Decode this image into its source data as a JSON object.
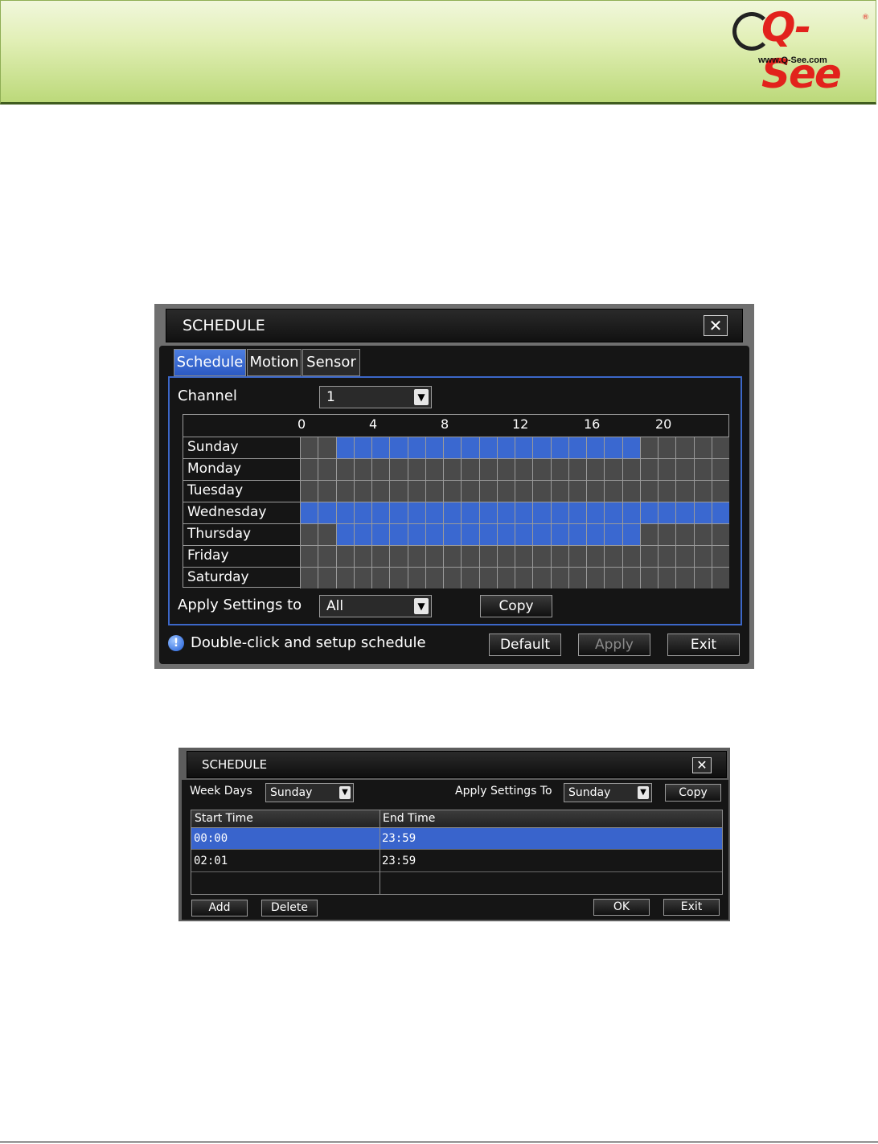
{
  "banner": {
    "logo_text": "Q-See",
    "logo_url": "www.Q-See.com",
    "logo_reg": "®"
  },
  "schedule_grid_dialog": {
    "title": "SCHEDULE",
    "close_label": "✕",
    "tabs": [
      {
        "label": "Schedule",
        "active": true
      },
      {
        "label": "Motion",
        "active": false
      },
      {
        "label": "Sensor",
        "active": false
      }
    ],
    "channel_label": "Channel",
    "channel_value": "1",
    "hour_labels": [
      "0",
      "4",
      "8",
      "12",
      "16",
      "20"
    ],
    "days": [
      {
        "name": "Sunday",
        "active_hours": [
          2,
          3,
          4,
          5,
          6,
          7,
          8,
          9,
          10,
          11,
          12,
          13,
          14,
          15,
          16,
          17,
          18
        ]
      },
      {
        "name": "Monday",
        "active_hours": []
      },
      {
        "name": "Tuesday",
        "active_hours": []
      },
      {
        "name": "Wednesday",
        "active_hours": [
          0,
          1,
          2,
          3,
          4,
          5,
          6,
          7,
          8,
          9,
          10,
          11,
          12,
          13,
          14,
          15,
          16,
          17,
          18,
          19,
          20,
          21,
          22,
          23
        ]
      },
      {
        "name": "Thursday",
        "active_hours": [
          2,
          3,
          4,
          5,
          6,
          7,
          8,
          9,
          10,
          11,
          12,
          13,
          14,
          15,
          16,
          17,
          18
        ]
      },
      {
        "name": "Friday",
        "active_hours": []
      },
      {
        "name": "Saturday",
        "active_hours": []
      }
    ],
    "apply_settings_label": "Apply  Settings  to",
    "apply_settings_value": "All",
    "copy_label": "Copy",
    "hint_text": "Double-click  and  setup  schedule",
    "default_label": "Default",
    "apply_label": "Apply",
    "exit_label": "Exit",
    "colors": {
      "active_cell": "#3a68d0",
      "inactive_cell": "#4a4a4a",
      "accent": "#3c67c8"
    }
  },
  "schedule_list_dialog": {
    "title": "SCHEDULE",
    "close_label": "✕",
    "week_days_label": "Week  Days",
    "week_days_value": "Sunday",
    "apply_settings_label": "Apply  Settings  To",
    "apply_settings_value": "Sunday",
    "copy_label": "Copy",
    "columns": [
      "Start  Time",
      "End  Time"
    ],
    "rows": [
      {
        "start": "00:00",
        "end": "23:59",
        "selected": true
      },
      {
        "start": "02:01",
        "end": "23:59",
        "selected": false
      }
    ],
    "add_label": "Add",
    "delete_label": "Delete",
    "ok_label": "OK",
    "exit_label": "Exit"
  }
}
